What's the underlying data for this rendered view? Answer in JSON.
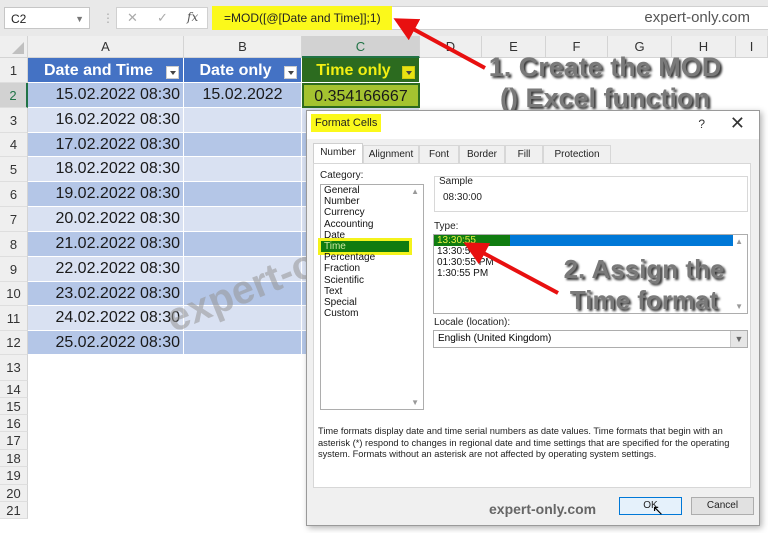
{
  "formula_bar": {
    "name_box": "C2",
    "cancel_icon": "✕",
    "enter_icon": "✓",
    "fx_label": "fx",
    "formula": "=MOD([@[Date and Time]];1)",
    "brand": "expert-only.com"
  },
  "columns": [
    "A",
    "B",
    "C",
    "D",
    "E",
    "F",
    "G",
    "H",
    "I"
  ],
  "rows": [
    "1",
    "2",
    "3",
    "4",
    "5",
    "6",
    "7",
    "8",
    "9",
    "10",
    "11",
    "12",
    "13",
    "14",
    "15",
    "16",
    "17",
    "18",
    "19",
    "20",
    "21"
  ],
  "table": {
    "headers": [
      "Date and Time",
      "Date only",
      "Time only"
    ],
    "data": [
      [
        "15.02.2022 08:30",
        "15.02.2022",
        "0.354166667"
      ],
      [
        "16.02.2022 08:30",
        "",
        ""
      ],
      [
        "17.02.2022 08:30",
        "",
        ""
      ],
      [
        "18.02.2022 08:30",
        "",
        ""
      ],
      [
        "19.02.2022 08:30",
        "",
        ""
      ],
      [
        "20.02.2022 08:30",
        "",
        ""
      ],
      [
        "21.02.2022 08:30",
        "",
        ""
      ],
      [
        "22.02.2022 08:30",
        "",
        ""
      ],
      [
        "23.02.2022 08:30",
        "",
        ""
      ],
      [
        "24.02.2022 08:30",
        "",
        ""
      ],
      [
        "25.02.2022 08:30",
        "",
        ""
      ]
    ]
  },
  "annotations": {
    "step1_line1": "1. Create the MOD",
    "step1_line2": "() Excel function",
    "step2_line1": "2. Assign the",
    "step2_line2": "Time format",
    "watermark": "expert-only.com"
  },
  "dialog": {
    "title": "Format Cells",
    "help": "?",
    "close": "✕",
    "tabs": [
      "Number",
      "Alignment",
      "Font",
      "Border",
      "Fill",
      "Protection"
    ],
    "active_tab": "Number",
    "category_label": "Category:",
    "categories": [
      "General",
      "Number",
      "Currency",
      "Accounting",
      "Date",
      "Time",
      "Percentage",
      "Fraction",
      "Scientific",
      "Text",
      "Special",
      "Custom"
    ],
    "selected_category": "Time",
    "sample_label": "Sample",
    "sample_value": "08:30:00",
    "type_label": "Type:",
    "types": [
      "13:30:55",
      "13:30:55",
      "01:30:55 PM",
      "1:30:55 PM"
    ],
    "selected_type": "13:30:55",
    "locale_label": "Locale (location):",
    "locale_value": "English (United Kingdom)",
    "description": "Time formats display date and time serial numbers as date values.  Time formats that begin with an asterisk (*) respond to changes in regional date and time settings that are specified for the operating system. Formats without an asterisk are not affected by operating system settings.",
    "brand": "expert-only.com",
    "ok_label": "OK",
    "cancel_label": "Cancel"
  },
  "colors": {
    "table_header": "#4472c4",
    "band_dark": "#b4c6e7",
    "band_light": "#d9e1f2",
    "highlight_yellow": "#fbf91b",
    "excel_green": "#217346",
    "arrow_red": "#e81010"
  }
}
